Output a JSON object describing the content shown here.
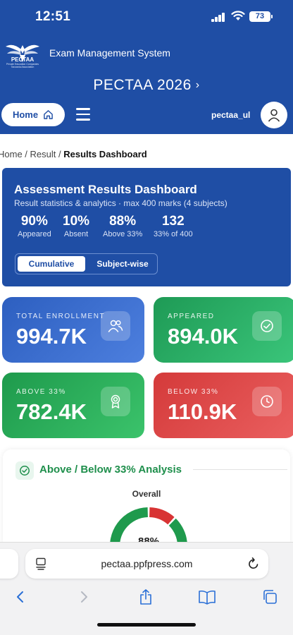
{
  "status": {
    "time": "12:51",
    "battery": "73"
  },
  "header": {
    "logo_text": "PECTAA",
    "logo_sub": "Private Education Companies Tanzania Association",
    "system_title": "Exam Management System",
    "year_label": "PECTAA 2026",
    "home_label": "Home",
    "username": "pectaa_ul"
  },
  "breadcrumb": {
    "home": "Home",
    "result": "Result",
    "current": "Results Dashboard"
  },
  "dashboard": {
    "title": "Assessment Results Dashboard",
    "subtitle": "Result statistics & analytics · max 400 marks (4 subjects)",
    "stats": [
      {
        "value": "90%",
        "label": "Appeared"
      },
      {
        "value": "10%",
        "label": "Absent"
      },
      {
        "value": "88%",
        "label": "Above 33%"
      },
      {
        "value": "132",
        "label": "33% of 400"
      }
    ],
    "toggle": {
      "active": "Cumulative",
      "inactive": "Subject-wise"
    }
  },
  "cards": [
    {
      "label": "TOTAL ENROLLMENT",
      "value": "994.7K",
      "icon": "users-icon"
    },
    {
      "label": "APPEARED",
      "value": "894.0K",
      "icon": "check-circle-icon"
    },
    {
      "label": "ABOVE 33%",
      "value": "782.4K",
      "icon": "award-icon"
    },
    {
      "label": "BELOW 33%",
      "value": "110.9K",
      "icon": "clock-icon"
    }
  ],
  "analysis": {
    "title": "Above / Below 33% Analysis",
    "chart_label": "Overall",
    "chart_value": "88%",
    "above_fraction": 0.88,
    "colors": {
      "above": "#1f9a4d",
      "below": "#d83434"
    }
  },
  "browser": {
    "url": "pectaa.ppfpress.com"
  }
}
